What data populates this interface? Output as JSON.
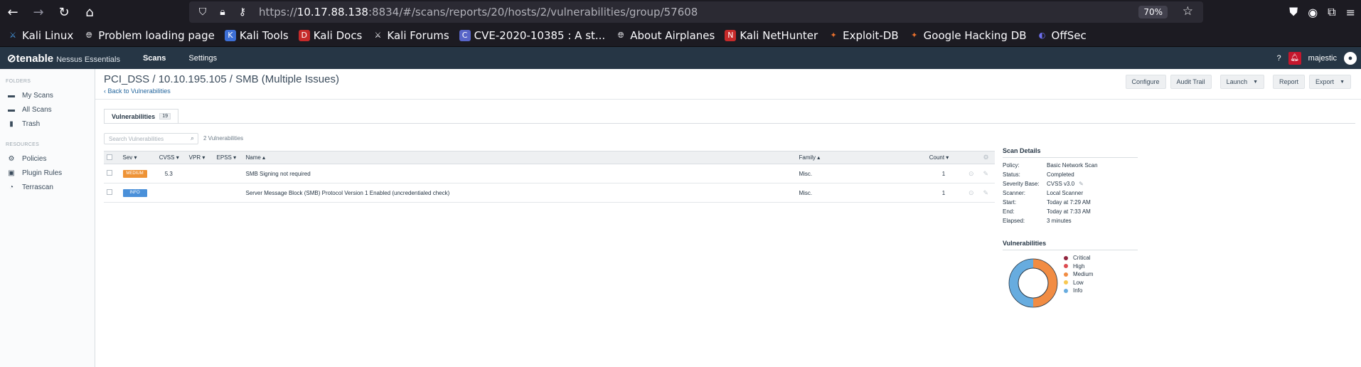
{
  "browser": {
    "url_prefix": "https://",
    "url_host": "10.17.88.138",
    "url_rest": ":8834/#/scans/reports/20/hosts/2/vulnerabilities/group/57608",
    "zoom": "70%"
  },
  "bookmarks": [
    {
      "label": "Kali Linux"
    },
    {
      "label": "Problem loading page"
    },
    {
      "label": "Kali Tools"
    },
    {
      "label": "Kali Docs"
    },
    {
      "label": "Kali Forums"
    },
    {
      "label": "CVE-2020-10385 : A st..."
    },
    {
      "label": "About Airplanes"
    },
    {
      "label": "Kali NetHunter"
    },
    {
      "label": "Exploit-DB"
    },
    {
      "label": "Google Hacking DB"
    },
    {
      "label": "OffSec"
    }
  ],
  "app": {
    "logo": "tenable",
    "logo_sub": "Nessus Essentials",
    "nav": [
      "Scans",
      "Settings"
    ],
    "user": "majestic"
  },
  "sidebar": {
    "folders_label": "FOLDERS",
    "folders": [
      "My Scans",
      "All Scans",
      "Trash"
    ],
    "resources_label": "RESOURCES",
    "resources": [
      "Policies",
      "Plugin Rules",
      "Terrascan"
    ]
  },
  "page": {
    "title": "PCI_DSS / 10.10.195.105 / SMB (Multiple Issues)",
    "back": "Back to Vulnerabilities",
    "actions": {
      "configure": "Configure",
      "audit": "Audit Trail",
      "launch": "Launch",
      "report": "Report",
      "export": "Export"
    },
    "tab_label": "Vulnerabilities",
    "tab_count": "19",
    "search_placeholder": "Search Vulnerabilities",
    "search_count": "2 Vulnerabilities"
  },
  "table": {
    "headers": {
      "sev": "Sev ▾",
      "cvss": "CVSS ▾",
      "vpr": "VPR ▾",
      "epss": "EPSS ▾",
      "name": "Name ▴",
      "family": "Family ▴",
      "count": "Count ▾"
    },
    "rows": [
      {
        "sev": "MEDIUM",
        "sev_color": "#ee9336",
        "cvss": "5.3",
        "vpr": "",
        "epss": "",
        "name": "SMB Signing not required",
        "family": "Misc.",
        "count": "1"
      },
      {
        "sev": "INFO",
        "sev_color": "#4a90d9",
        "cvss": "",
        "vpr": "",
        "epss": "",
        "name": "Server Message Block (SMB) Protocol Version 1 Enabled (uncredentialed check)",
        "family": "Misc.",
        "count": "1"
      }
    ]
  },
  "details": {
    "heading": "Scan Details",
    "rows": [
      {
        "k": "Policy:",
        "v": "Basic Network Scan"
      },
      {
        "k": "Status:",
        "v": "Completed"
      },
      {
        "k": "Severity Base:",
        "v": "CVSS v3.0"
      },
      {
        "k": "Scanner:",
        "v": "Local Scanner"
      },
      {
        "k": "Start:",
        "v": "Today at 7:29 AM"
      },
      {
        "k": "End:",
        "v": "Today at 7:33 AM"
      },
      {
        "k": "Elapsed:",
        "v": "3 minutes"
      }
    ]
  },
  "chart_data": {
    "type": "pie",
    "title": "Vulnerabilities",
    "categories": [
      "Critical",
      "High",
      "Medium",
      "Low",
      "Info"
    ],
    "values": [
      0,
      0,
      1,
      0,
      1
    ],
    "colors": [
      "#91243e",
      "#dd4b50",
      "#f18c43",
      "#f8c851",
      "#67acdf"
    ]
  }
}
